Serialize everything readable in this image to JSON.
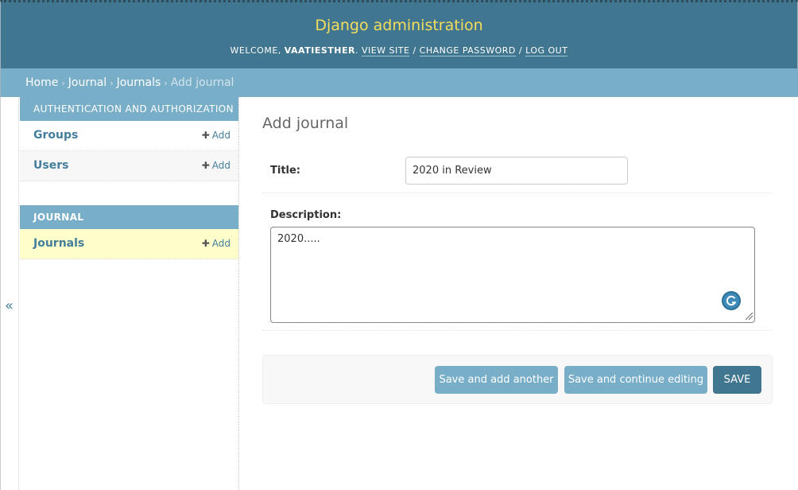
{
  "header": {
    "site_name": "Django administration",
    "welcome": "WELCOME,",
    "username": "VAATIESTHER",
    "links": [
      "VIEW SITE",
      "CHANGE PASSWORD",
      "LOG OUT"
    ]
  },
  "breadcrumbs": {
    "items": [
      "Home",
      "Journal",
      "Journals"
    ],
    "current": "Add journal"
  },
  "nav": {
    "collapse_label": "«",
    "modules": [
      {
        "caption": "AUTHENTICATION AND AUTHORIZATION",
        "models": [
          {
            "name": "Groups",
            "add": "Add"
          },
          {
            "name": "Users",
            "add": "Add"
          }
        ]
      },
      {
        "caption": "JOURNAL",
        "models": [
          {
            "name": "Journals",
            "add": "Add"
          }
        ]
      }
    ]
  },
  "form": {
    "page_title": "Add journal",
    "title_label": "Title:",
    "title_value": "2020 in Review",
    "description_label": "Description:",
    "description_value": "2020....."
  },
  "buttons": {
    "save_add_another": "Save and add another",
    "save_continue": "Save and continue editing",
    "save": "Save"
  },
  "colors": {
    "header_bg": "#417690",
    "site_name": "#f5dd5d",
    "breadcrumbs_bg": "#79aec8",
    "link": "#447e9b",
    "current_row": "#ffffcc"
  }
}
